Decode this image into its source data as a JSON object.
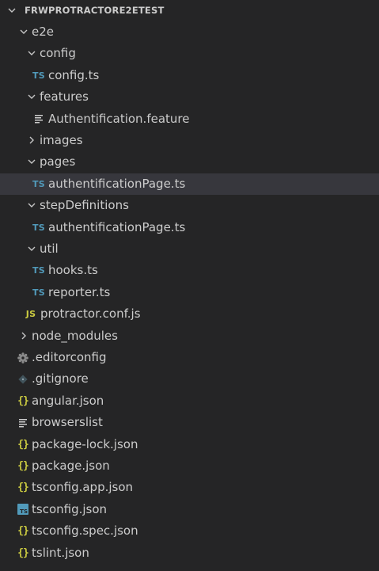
{
  "explorer": {
    "title": "FRWPROTRACTORE2ETEST",
    "items": [
      {
        "label": "e2e",
        "type": "folder",
        "expanded": true,
        "depth": 0,
        "icon": "chevron-down-icon"
      },
      {
        "label": "config",
        "type": "folder",
        "expanded": true,
        "depth": 1,
        "icon": "chevron-down-icon"
      },
      {
        "label": "config.ts",
        "type": "file",
        "depth": 2,
        "icon": "typescript-icon",
        "icon_text": "TS"
      },
      {
        "label": "features",
        "type": "folder",
        "expanded": true,
        "depth": 1,
        "icon": "chevron-down-icon"
      },
      {
        "label": "Authentification.feature",
        "type": "file",
        "depth": 2,
        "icon": "text-lines-icon"
      },
      {
        "label": "images",
        "type": "folder",
        "expanded": false,
        "depth": 1,
        "icon": "chevron-right-icon"
      },
      {
        "label": "pages",
        "type": "folder",
        "expanded": true,
        "depth": 1,
        "icon": "chevron-down-icon"
      },
      {
        "label": "authentificationPage.ts",
        "type": "file",
        "depth": 2,
        "icon": "typescript-icon",
        "icon_text": "TS",
        "selected": true
      },
      {
        "label": "stepDefinitions",
        "type": "folder",
        "expanded": true,
        "depth": 1,
        "icon": "chevron-down-icon"
      },
      {
        "label": "authentificationPage.ts",
        "type": "file",
        "depth": 2,
        "icon": "typescript-icon",
        "icon_text": "TS"
      },
      {
        "label": "util",
        "type": "folder",
        "expanded": true,
        "depth": 1,
        "icon": "chevron-down-icon"
      },
      {
        "label": "hooks.ts",
        "type": "file",
        "depth": 2,
        "icon": "typescript-icon",
        "icon_text": "TS"
      },
      {
        "label": "reporter.ts",
        "type": "file",
        "depth": 2,
        "icon": "typescript-icon",
        "icon_text": "TS"
      },
      {
        "label": "protractor.conf.js",
        "type": "file",
        "depth": 1,
        "icon": "javascript-icon",
        "icon_text": "JS"
      },
      {
        "label": "node_modules",
        "type": "folder",
        "expanded": false,
        "depth": 0,
        "icon": "chevron-right-icon"
      },
      {
        "label": ".editorconfig",
        "type": "file",
        "depth": 0,
        "icon": "gear-icon"
      },
      {
        "label": ".gitignore",
        "type": "file",
        "depth": 0,
        "icon": "git-diamond-icon"
      },
      {
        "label": "angular.json",
        "type": "file",
        "depth": 0,
        "icon": "json-braces-icon",
        "icon_text": "{}"
      },
      {
        "label": "browserslist",
        "type": "file",
        "depth": 0,
        "icon": "text-lines-icon"
      },
      {
        "label": "package-lock.json",
        "type": "file",
        "depth": 0,
        "icon": "json-braces-icon",
        "icon_text": "{}"
      },
      {
        "label": "package.json",
        "type": "file",
        "depth": 0,
        "icon": "json-braces-icon",
        "icon_text": "{}"
      },
      {
        "label": "tsconfig.app.json",
        "type": "file",
        "depth": 0,
        "icon": "json-braces-icon",
        "icon_text": "{}"
      },
      {
        "label": "tsconfig.json",
        "type": "file",
        "depth": 0,
        "icon": "tsconfig-icon",
        "icon_text": "TS"
      },
      {
        "label": "tsconfig.spec.json",
        "type": "file",
        "depth": 0,
        "icon": "json-braces-icon",
        "icon_text": "{}"
      },
      {
        "label": "tslint.json",
        "type": "file",
        "depth": 0,
        "icon": "json-braces-icon",
        "icon_text": "{}"
      }
    ]
  },
  "colors": {
    "background": "#252526",
    "selected_row": "#37373d",
    "text": "#cccccc",
    "typescript": "#519aba",
    "javascript": "#cbcb41",
    "json": "#cbcb41",
    "chevron": "#c5c5c5",
    "muted_icon": "#8a8a8a",
    "git_icon": "#41535b"
  }
}
